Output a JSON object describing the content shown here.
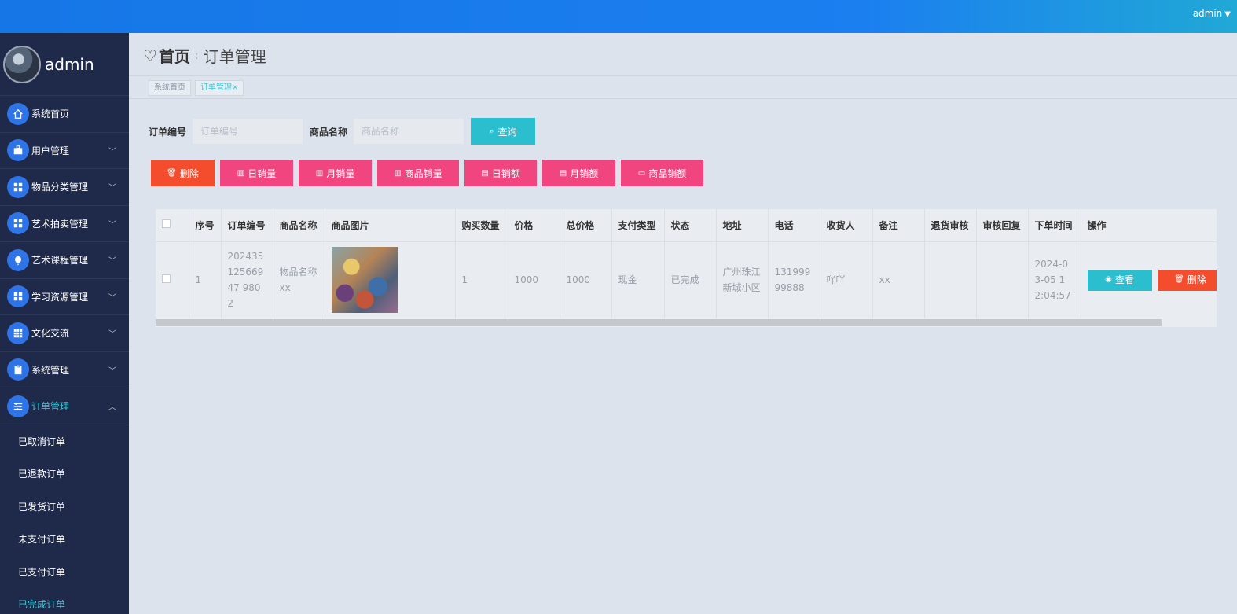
{
  "topbar": {
    "user": "admin"
  },
  "sidebar": {
    "username": "admin",
    "items": [
      {
        "label": "系统首页",
        "icon": "home-icon",
        "expandable": false
      },
      {
        "label": "用户管理",
        "icon": "briefcase-icon",
        "expandable": true
      },
      {
        "label": "物品分类管理",
        "icon": "grid-icon",
        "expandable": true
      },
      {
        "label": "艺术拍卖管理",
        "icon": "grid-icon",
        "expandable": true
      },
      {
        "label": "艺术课程管理",
        "icon": "balloon-icon",
        "expandable": true
      },
      {
        "label": "学习资源管理",
        "icon": "grid-icon",
        "expandable": true
      },
      {
        "label": "文化交流",
        "icon": "table-icon",
        "expandable": true
      },
      {
        "label": "系统管理",
        "icon": "clipboard-icon",
        "expandable": true
      },
      {
        "label": "订单管理",
        "icon": "sliders-icon",
        "expandable": true,
        "expanded": true
      }
    ],
    "subitems": [
      "已取消订单",
      "已退款订单",
      "已发货订单",
      "未支付订单",
      "已支付订单",
      "已完成订单"
    ],
    "active_subitem": "已完成订单"
  },
  "breadcrumb": {
    "home": "首页",
    "current": "订单管理"
  },
  "tags": [
    {
      "label": "系统首页"
    },
    {
      "label": "订单管理",
      "closable": "×"
    }
  ],
  "search": {
    "order_no_label": "订单编号",
    "order_no_placeholder": "订单编号",
    "product_name_label": "商品名称",
    "product_name_placeholder": "商品名称",
    "query_label": "查询"
  },
  "actions": {
    "delete": "删除",
    "daily_volume": "日销量",
    "monthly_volume": "月销量",
    "product_volume": "商品销量",
    "daily_amount": "日销额",
    "monthly_amount": "月销额",
    "product_amount": "商品销额"
  },
  "table": {
    "headers": [
      "序号",
      "订单编号",
      "商品名称",
      "商品图片",
      "购买数量",
      "价格",
      "总价格",
      "支付类型",
      "状态",
      "地址",
      "电话",
      "收货人",
      "备注",
      "退货审核",
      "审核回复",
      "下单时间",
      "操作"
    ],
    "rows": [
      {
        "index": "1",
        "order_no": "20243512566947 9802",
        "product_name": "物品名称xx",
        "quantity": "1",
        "price": "1000",
        "total": "1000",
        "pay_type": "现金",
        "status": "已完成",
        "address": "广州珠江新城小区",
        "phone": "13199999888",
        "receiver": "吖吖",
        "remark": "xx",
        "return_review": "",
        "review_reply": "",
        "order_time": "2024-03-05 12:04:57",
        "view_label": "查看",
        "delete_label": "删除"
      }
    ]
  },
  "colors": {
    "accent": "#2bbecf",
    "danger": "#f34d2e",
    "pink": "#f0457f",
    "sidebar": "#1f2a4a"
  }
}
